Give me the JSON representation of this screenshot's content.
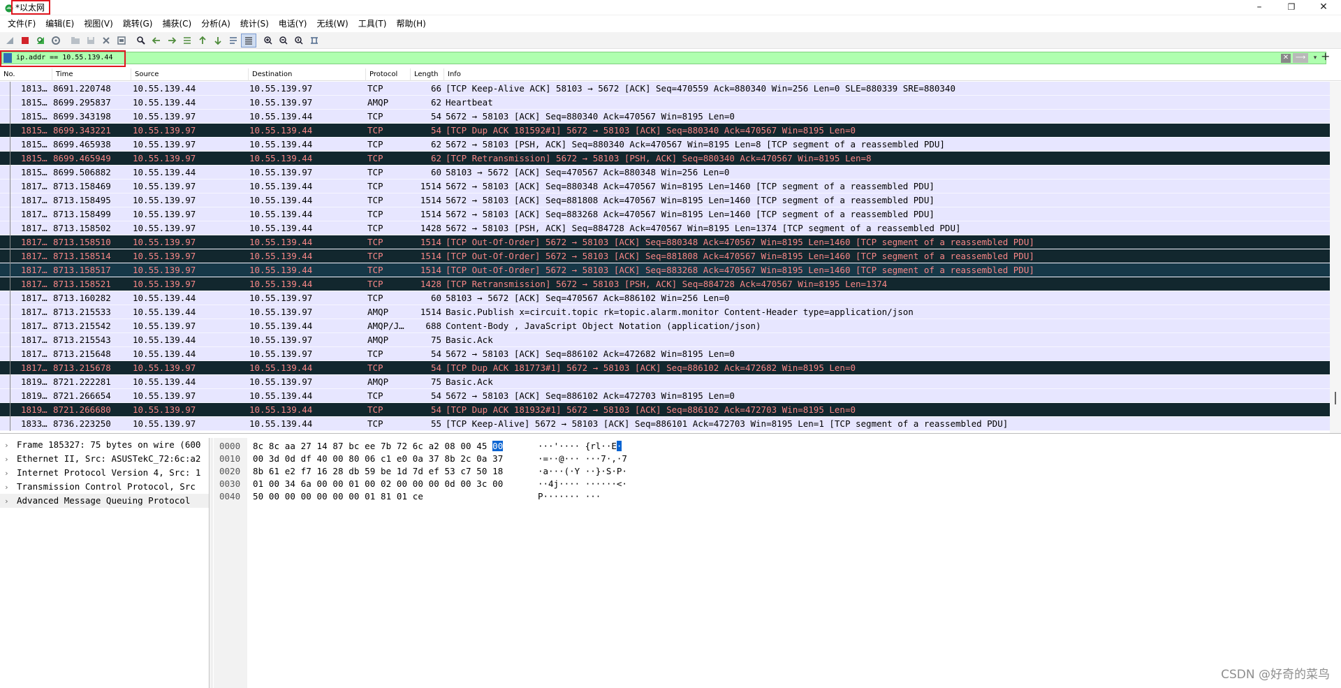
{
  "window": {
    "title": "*以太网",
    "minimize": "–",
    "restore": "❐",
    "close": "✕"
  },
  "menu": [
    "文件(F)",
    "编辑(E)",
    "视图(V)",
    "跳转(G)",
    "捕获(C)",
    "分析(A)",
    "统计(S)",
    "电话(Y)",
    "无线(W)",
    "工具(T)",
    "帮助(H)"
  ],
  "toolbar_icons": [
    "shark-fin-start-icon",
    "stop-capture-icon",
    "restart-capture-icon",
    "capture-options-icon",
    "open-file-icon",
    "save-file-icon",
    "close-file-icon",
    "reload-file-icon",
    "find-packet-icon",
    "go-back-icon",
    "go-forward-icon",
    "go-to-packet-icon",
    "go-first-icon",
    "go-last-icon",
    "auto-scroll-icon",
    "colorize-icon",
    "zoom-in-icon",
    "zoom-out-icon",
    "zoom-normal-icon",
    "resize-columns-icon"
  ],
  "filter": {
    "value": "ip.addr == 10.55.139.44",
    "clear_glyph": "✕",
    "apply_glyph": "⟶",
    "dropdown_glyph": "▾",
    "add_glyph": "+"
  },
  "columns": {
    "no": "No.",
    "time": "Time",
    "source": "Source",
    "destination": "Destination",
    "protocol": "Protocol",
    "length": "Length",
    "info": "Info"
  },
  "packets": [
    {
      "no": "1813…",
      "time": "8691.220748",
      "src": "10.55.139.44",
      "dst": "10.55.139.97",
      "proto": "TCP",
      "len": "66",
      "info": "[TCP Keep-Alive ACK] 58103 → 5672 [ACK] Seq=470559 Ack=880340 Win=256 Len=0 SLE=880339 SRE=880340",
      "style": "normal"
    },
    {
      "no": "1815…",
      "time": "8699.295837",
      "src": "10.55.139.44",
      "dst": "10.55.139.97",
      "proto": "AMQP",
      "len": "62",
      "info": "Heartbeat",
      "style": "normal"
    },
    {
      "no": "1815…",
      "time": "8699.343198",
      "src": "10.55.139.97",
      "dst": "10.55.139.44",
      "proto": "TCP",
      "len": "54",
      "info": "5672 → 58103 [ACK] Seq=880340 Ack=470567 Win=8195 Len=0",
      "style": "normal"
    },
    {
      "no": "1815…",
      "time": "8699.343221",
      "src": "10.55.139.97",
      "dst": "10.55.139.44",
      "proto": "TCP",
      "len": "54",
      "info": "[TCP Dup ACK 181592#1] 5672 → 58103 [ACK] Seq=880340 Ack=470567 Win=8195 Len=0",
      "style": "bad"
    },
    {
      "no": "1815…",
      "time": "8699.465938",
      "src": "10.55.139.97",
      "dst": "10.55.139.44",
      "proto": "TCP",
      "len": "62",
      "info": "5672 → 58103 [PSH, ACK] Seq=880340 Ack=470567 Win=8195 Len=8 [TCP segment of a reassembled PDU]",
      "style": "normal"
    },
    {
      "no": "1815…",
      "time": "8699.465949",
      "src": "10.55.139.97",
      "dst": "10.55.139.44",
      "proto": "TCP",
      "len": "62",
      "info": "[TCP Retransmission] 5672 → 58103 [PSH, ACK] Seq=880340 Ack=470567 Win=8195 Len=8",
      "style": "bad"
    },
    {
      "no": "1815…",
      "time": "8699.506882",
      "src": "10.55.139.44",
      "dst": "10.55.139.97",
      "proto": "TCP",
      "len": "60",
      "info": "58103 → 5672 [ACK] Seq=470567 Ack=880348 Win=256 Len=0",
      "style": "normal"
    },
    {
      "no": "1817…",
      "time": "8713.158469",
      "src": "10.55.139.97",
      "dst": "10.55.139.44",
      "proto": "TCP",
      "len": "1514",
      "info": "5672 → 58103 [ACK] Seq=880348 Ack=470567 Win=8195 Len=1460 [TCP segment of a reassembled PDU]",
      "style": "normal"
    },
    {
      "no": "1817…",
      "time": "8713.158495",
      "src": "10.55.139.97",
      "dst": "10.55.139.44",
      "proto": "TCP",
      "len": "1514",
      "info": "5672 → 58103 [ACK] Seq=881808 Ack=470567 Win=8195 Len=1460 [TCP segment of a reassembled PDU]",
      "style": "normal"
    },
    {
      "no": "1817…",
      "time": "8713.158499",
      "src": "10.55.139.97",
      "dst": "10.55.139.44",
      "proto": "TCP",
      "len": "1514",
      "info": "5672 → 58103 [ACK] Seq=883268 Ack=470567 Win=8195 Len=1460 [TCP segment of a reassembled PDU]",
      "style": "normal"
    },
    {
      "no": "1817…",
      "time": "8713.158502",
      "src": "10.55.139.97",
      "dst": "10.55.139.44",
      "proto": "TCP",
      "len": "1428",
      "info": "5672 → 58103 [PSH, ACK] Seq=884728 Ack=470567 Win=8195 Len=1374 [TCP segment of a reassembled PDU]",
      "style": "normal"
    },
    {
      "no": "1817…",
      "time": "8713.158510",
      "src": "10.55.139.97",
      "dst": "10.55.139.44",
      "proto": "TCP",
      "len": "1514",
      "info": "[TCP Out-Of-Order] 5672 → 58103 [ACK] Seq=880348 Ack=470567 Win=8195 Len=1460 [TCP segment of a reassembled PDU]",
      "style": "bad"
    },
    {
      "no": "1817…",
      "time": "8713.158514",
      "src": "10.55.139.97",
      "dst": "10.55.139.44",
      "proto": "TCP",
      "len": "1514",
      "info": "[TCP Out-Of-Order] 5672 → 58103 [ACK] Seq=881808 Ack=470567 Win=8195 Len=1460 [TCP segment of a reassembled PDU]",
      "style": "bad"
    },
    {
      "no": "1817…",
      "time": "8713.158517",
      "src": "10.55.139.97",
      "dst": "10.55.139.44",
      "proto": "TCP",
      "len": "1514",
      "info": "[TCP Out-Of-Order] 5672 → 58103 [ACK] Seq=883268 Ack=470567 Win=8195 Len=1460 [TCP segment of a reassembled PDU]",
      "style": "bad-sel"
    },
    {
      "no": "1817…",
      "time": "8713.158521",
      "src": "10.55.139.97",
      "dst": "10.55.139.44",
      "proto": "TCP",
      "len": "1428",
      "info": "[TCP Retransmission] 5672 → 58103 [PSH, ACK] Seq=884728 Ack=470567 Win=8195 Len=1374",
      "style": "bad"
    },
    {
      "no": "1817…",
      "time": "8713.160282",
      "src": "10.55.139.44",
      "dst": "10.55.139.97",
      "proto": "TCP",
      "len": "60",
      "info": "58103 → 5672 [ACK] Seq=470567 Ack=886102 Win=256 Len=0",
      "style": "normal"
    },
    {
      "no": "1817…",
      "time": "8713.215533",
      "src": "10.55.139.44",
      "dst": "10.55.139.97",
      "proto": "AMQP",
      "len": "1514",
      "info": "Basic.Publish x=circuit.topic rk=topic.alarm.monitor Content-Header type=application/json",
      "style": "normal"
    },
    {
      "no": "1817…",
      "time": "8713.215542",
      "src": "10.55.139.97",
      "dst": "10.55.139.44",
      "proto": "AMQP/J…",
      "len": "688",
      "info": "Content-Body , JavaScript Object Notation (application/json)",
      "style": "normal"
    },
    {
      "no": "1817…",
      "time": "8713.215543",
      "src": "10.55.139.44",
      "dst": "10.55.139.97",
      "proto": "AMQP",
      "len": "75",
      "info": "Basic.Ack",
      "style": "normal"
    },
    {
      "no": "1817…",
      "time": "8713.215648",
      "src": "10.55.139.44",
      "dst": "10.55.139.97",
      "proto": "TCP",
      "len": "54",
      "info": "5672 → 58103 [ACK] Seq=886102 Ack=472682 Win=8195 Len=0",
      "style": "normal"
    },
    {
      "no": "1817…",
      "time": "8713.215678",
      "src": "10.55.139.97",
      "dst": "10.55.139.44",
      "proto": "TCP",
      "len": "54",
      "info": "[TCP Dup ACK 181773#1] 5672 → 58103 [ACK] Seq=886102 Ack=472682 Win=8195 Len=0",
      "style": "bad"
    },
    {
      "no": "1819…",
      "time": "8721.222281",
      "src": "10.55.139.44",
      "dst": "10.55.139.97",
      "proto": "AMQP",
      "len": "75",
      "info": "Basic.Ack",
      "style": "normal"
    },
    {
      "no": "1819…",
      "time": "8721.266654",
      "src": "10.55.139.97",
      "dst": "10.55.139.44",
      "proto": "TCP",
      "len": "54",
      "info": "5672 → 58103 [ACK] Seq=886102 Ack=472703 Win=8195 Len=0",
      "style": "normal"
    },
    {
      "no": "1819…",
      "time": "8721.266680",
      "src": "10.55.139.97",
      "dst": "10.55.139.44",
      "proto": "TCP",
      "len": "54",
      "info": "[TCP Dup ACK 181932#1] 5672 → 58103 [ACK] Seq=886102 Ack=472703 Win=8195 Len=0",
      "style": "bad"
    },
    {
      "no": "1833…",
      "time": "8736.223250",
      "src": "10.55.139.97",
      "dst": "10.55.139.44",
      "proto": "TCP",
      "len": "55",
      "info": "[TCP Keep-Alive] 5672 → 58103 [ACK] Seq=886101 Ack=472703 Win=8195 Len=1 [TCP segment of a reassembled PDU]",
      "style": "normal"
    }
  ],
  "details": [
    {
      "label": "Frame 185327: 75 bytes on wire (600",
      "selected": false
    },
    {
      "label": "Ethernet II, Src: ASUSTekC_72:6c:a2",
      "selected": false
    },
    {
      "label": "Internet Protocol Version 4, Src: 1",
      "selected": false
    },
    {
      "label": "Transmission Control Protocol, Src",
      "selected": false
    },
    {
      "label": "Advanced Message Queuing Protocol",
      "selected": true
    }
  ],
  "detail_arrow": "›",
  "bytes": [
    {
      "offset": "0000",
      "hex_pre": "8c 8c aa 27 14 87 bc ee  7b 72 6c a2 08 00 45 ",
      "hex_hl": "00",
      "ascii_pre": "···'···· {rl··E",
      "ascii_hl": "·"
    },
    {
      "offset": "0010",
      "hex_pre": "00 3d 0d df 40 00 80 06  c1 e0 0a 37 8b 2c 0a 37",
      "hex_hl": "",
      "ascii_pre": "·=··@··· ···7·,·7",
      "ascii_hl": ""
    },
    {
      "offset": "0020",
      "hex_pre": "8b 61 e2 f7 16 28 db 59  be 1d 7d ef 53 c7 50 18",
      "hex_hl": "",
      "ascii_pre": "·a···(·Y ··}·S·P·",
      "ascii_hl": ""
    },
    {
      "offset": "0030",
      "hex_pre": "01 00 34 6a 00 00 01 00  02 00 00 00 0d 00 3c 00",
      "hex_hl": "",
      "ascii_pre": "··4j···· ······<·",
      "ascii_hl": ""
    },
    {
      "offset": "0040",
      "hex_pre": "50 00 00 00 00 00 00 01  81 01 ce",
      "hex_hl": "",
      "ascii_pre": "P······· ···",
      "ascii_hl": ""
    }
  ],
  "watermark": "CSDN @好奇的菜鸟"
}
